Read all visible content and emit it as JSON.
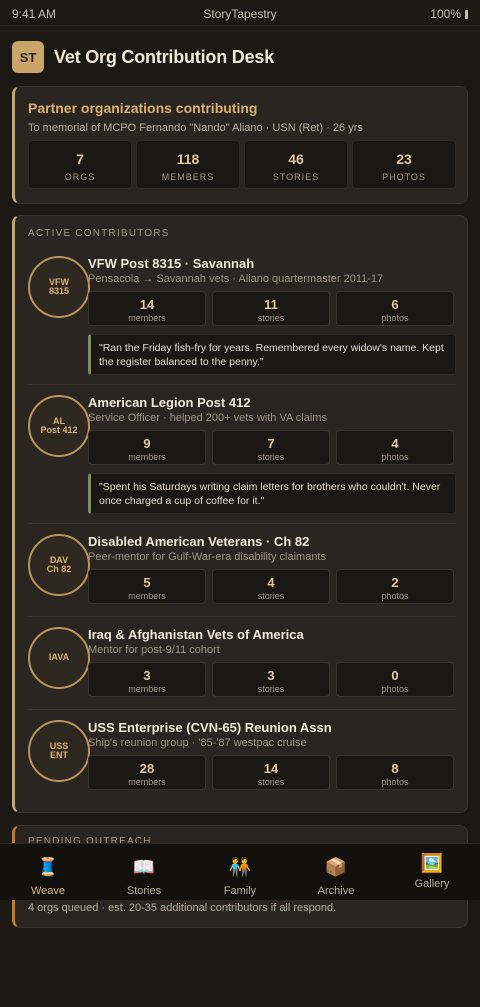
{
  "status_bar": {
    "time": "9:41 AM",
    "app_name": "StoryTapestry",
    "battery": "100%"
  },
  "header": {
    "logo": "ST",
    "title": "Vet Org Contribution Desk"
  },
  "summary": {
    "title": "Partner organizations contributing",
    "subtitle": "To memorial of MCPO Fernando \"Nando\" Aliano · USN (Ret) · 26 yrs",
    "stats": [
      {
        "value": "7",
        "label": "ORGS"
      },
      {
        "value": "118",
        "label": "MEMBERS"
      },
      {
        "value": "46",
        "label": "STORIES"
      },
      {
        "value": "23",
        "label": "PHOTOS"
      }
    ]
  },
  "contributors": {
    "heading": "ACTIVE CONTRIBUTORS",
    "orgs": [
      {
        "badge": "VFW\n8315",
        "name": "VFW Post 8315 · Savannah",
        "subtitle": "Pensacola → Savannah vets · Aliano quartermaster 2011-17",
        "members": "14",
        "stories": "11",
        "photos": "6",
        "quote": "\"Ran the Friday fish-fry for years. Remembered every widow's name. Kept the register balanced to the penny.\""
      },
      {
        "badge": "AL\nPost 412",
        "name": "American Legion Post 412",
        "subtitle": "Service Officer · helped 200+ vets with VA claims",
        "members": "9",
        "stories": "7",
        "photos": "4",
        "quote": "\"Spent his Saturdays writing claim letters for brothers who couldn't. Never once charged a cup of coffee for it.\""
      },
      {
        "badge": "DAV\nCh 82",
        "name": "Disabled American Veterans · Ch 82",
        "subtitle": "Peer-mentor for Gulf-War-era disability claimants",
        "members": "5",
        "stories": "4",
        "photos": "2"
      },
      {
        "badge": "IAVA",
        "name": "Iraq & Afghanistan Vets of America",
        "subtitle": "Mentor for post-9/11 cohort",
        "members": "3",
        "stories": "3",
        "photos": "0"
      },
      {
        "badge": "USS\nENT",
        "name": "USS Enterprise (CVN-65) Reunion Assn",
        "subtitle": "Ship's reunion group · '85-'87 westpac cruise",
        "members": "28",
        "stories": "14",
        "photos": "8"
      }
    ],
    "stat_labels": {
      "members": "members",
      "stories": "stories",
      "photos": "photos"
    }
  },
  "pending": {
    "heading": "PENDING OUTREACH",
    "text": "4 orgs queued · est. 20-35 additional contributors if all respond."
  },
  "tabs": [
    {
      "label": "Weave",
      "icon": "🧵",
      "icon_name": "spool-icon",
      "active": true
    },
    {
      "label": "Stories",
      "icon": "📖",
      "icon_name": "book-icon",
      "active": false
    },
    {
      "label": "Family",
      "icon": "🧑‍🤝‍🧑",
      "icon_name": "family-icon",
      "active": false
    },
    {
      "label": "Archive",
      "icon": "📦",
      "icon_name": "box-icon",
      "active": false
    },
    {
      "label": "Gallery",
      "icon": "🖼️",
      "icon_name": "picture-icon",
      "active": false
    }
  ],
  "colors": {
    "accent": "#c9a56b",
    "background": "#1c1915",
    "card": "#2a2520",
    "quote_border": "#7c8f5e",
    "pending_border": "#c9782a"
  }
}
